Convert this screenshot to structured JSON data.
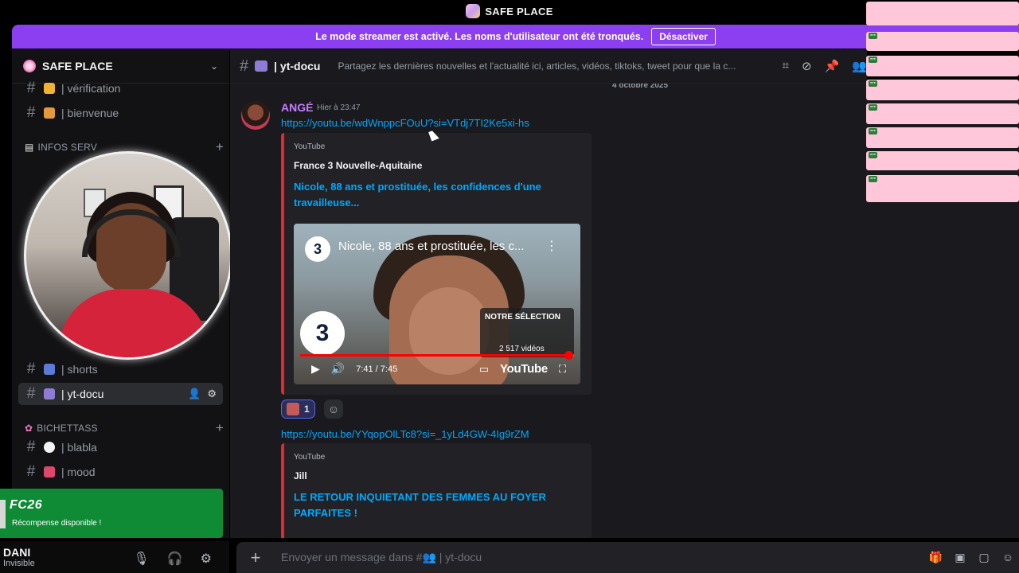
{
  "window": {
    "title": "SAFE PLACE"
  },
  "banner": {
    "message": "Le mode streamer est activé. Les noms d'utilisateur ont été tronqués.",
    "button": "Désactiver"
  },
  "server": {
    "name": "SAFE PLACE"
  },
  "sidebar": {
    "channels_top": [
      {
        "label": "| vérification"
      },
      {
        "label": "| bienvenue"
      }
    ],
    "category_infos": "INFOS SERV",
    "channel_shorts": "| shorts",
    "channel_active": "| yt-docu",
    "category_bichettass": "BICHETTASS",
    "channels_bottom": [
      {
        "label": "| blabla"
      },
      {
        "label": "| mood"
      }
    ]
  },
  "promo": {
    "logo": "FC26",
    "subtitle": "Récompense disponible !"
  },
  "user": {
    "name": "DANI",
    "status": "Invisible"
  },
  "header": {
    "channel": "| yt-docu",
    "topic": "Partagez les dernières nouvelles et l'actualité ici, articles, vidéos, tiktoks, tweet pour que la c..."
  },
  "chat": {
    "date_divider": "4 octobre 2025",
    "message": {
      "author": "ANGÉ",
      "time": "Hier à 23:47",
      "link1": "https://youtu.be/wdWnppcFOuU?si=VTdj7TI2Ke5xi-hs",
      "embed1": {
        "provider": "YouTube",
        "author": "France 3 Nouvelle-Aquitaine",
        "title": "Nicole, 88 ans et prostituée, les confidences d'une travailleuse...",
        "video_title": "Nicole, 88 ans et prostituée, les c...",
        "time": "7:41 / 7:45",
        "progress": 0.98,
        "selection_title": "NOTRE SÉLECTION",
        "selection_count": "2 517 vidéos",
        "channel_logo": "3",
        "yt_logo": "YouTube"
      },
      "reaction_count": "1",
      "link2": "https://youtu.be/YYqopOlLTc8?si=_1yLd4GW-4Ig9rZM",
      "embed2": {
        "provider": "YouTube",
        "author": "Jill",
        "title": "LE RETOUR INQUIETANT DES FEMMES AU FOYER PARFAITES !"
      }
    }
  },
  "composer": {
    "placeholder": "Envoyer un message dans #👥 | yt-docu"
  },
  "colors": {
    "banner": "#8c3ff0",
    "promo": "#0f8a35",
    "link": "#00a8fc",
    "embed_border": "#e3272b",
    "author": "#c77dff"
  }
}
